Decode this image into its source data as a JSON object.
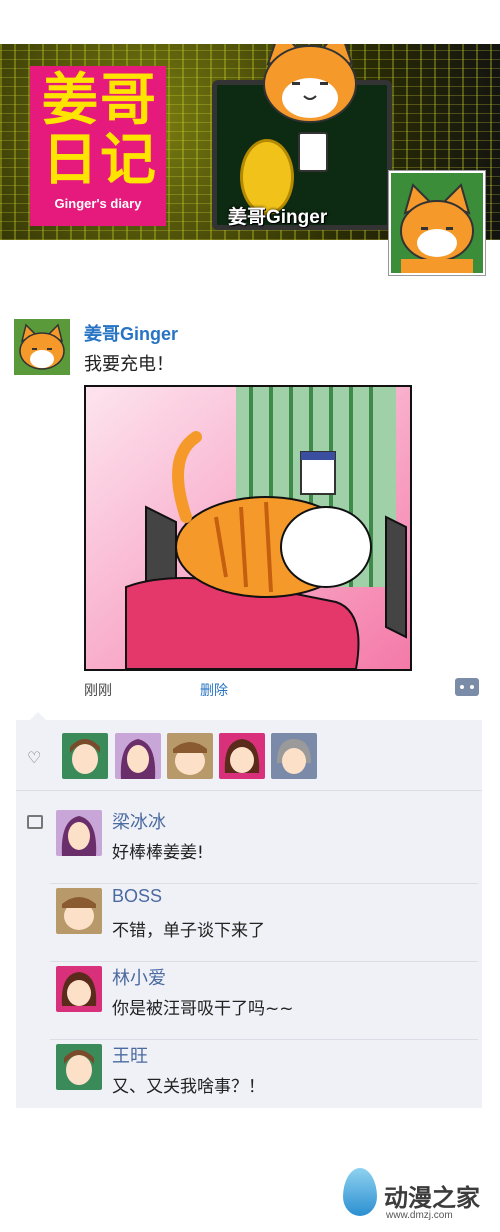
{
  "banner": {
    "logo_line1": "姜哥",
    "logo_line2": "日记",
    "logo_sub": "Ginger's diary",
    "character_name": "姜哥Ginger"
  },
  "post": {
    "author": "姜哥Ginger",
    "text": "我要充电！",
    "time": "刚刚",
    "delete_label": "删除"
  },
  "likes": {
    "icon": "heart-icon",
    "count_avatars": 5
  },
  "comments": [
    {
      "name": "梁冰冰",
      "text": "好棒棒姜姜!"
    },
    {
      "name": "BOSS",
      "text": "不错，单子谈下来了"
    },
    {
      "name": "林小爱",
      "text": "你是被汪哥吸干了吗~~"
    },
    {
      "name": "王旺",
      "text": "又、又关我啥事？！"
    }
  ],
  "watermark": {
    "title": "动漫之家",
    "url": "www.dmzj.com"
  },
  "colors": {
    "logo_bg": "#e6197d",
    "logo_text": "#ffe400",
    "link_blue": "#2874c4",
    "comment_name": "#4a6aa0",
    "panel_bg": "#f0f1f7"
  }
}
